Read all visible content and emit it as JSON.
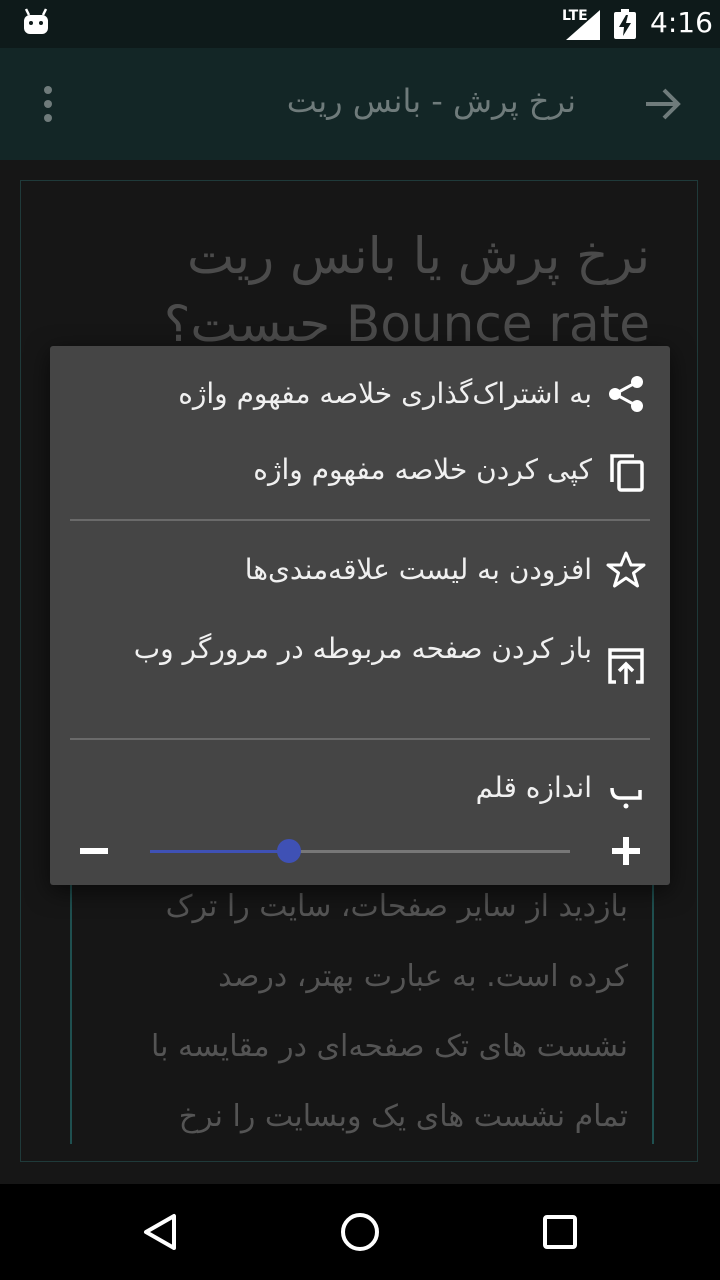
{
  "status_bar": {
    "network": "LTE",
    "time": "4:16",
    "icons": [
      "android-icon",
      "signal-icon",
      "battery-charging-icon"
    ]
  },
  "app_bar": {
    "title": "نرخ پرش - بانس ریت",
    "icons": [
      "more-vert-icon",
      "arrow-forward-icon"
    ]
  },
  "article": {
    "heading": "نرخ پرش یا بانس ریت\nBounce rate چیست؟",
    "paragraph": "بازدید از سایر صفحات، سایت را ترک\nکرده است. به عبارت بهتر، درصد\nنشست های تک صفحه‌ای در مقایسه با\nتمام نشست های یک وبسایت را نرخ"
  },
  "popup_menu": {
    "items": [
      {
        "label": "به اشتراک‌گذاری خلاصه مفهوم واژه",
        "icon": "share-icon"
      },
      {
        "label": "کپی کردن خلاصه مفهوم واژه",
        "icon": "copy-icon"
      },
      {
        "label": "افزودن به لیست علاقه‌مندی‌ها",
        "icon": "star-outline-icon"
      },
      {
        "label": "باز کردن صفحه مربوطه در مرورگر وب",
        "icon": "open-in-browser-icon"
      },
      {
        "label": "اندازه قلم",
        "icon": "font-size-icon"
      }
    ],
    "font_size_slider": {
      "value_fraction": 0.33
    }
  },
  "nav_bar": {
    "icons": [
      "back-triangle-icon",
      "home-circle-icon",
      "recents-square-icon"
    ]
  },
  "colors": {
    "status_bar_bg": "#0e1a1a",
    "app_bar_bg": "#132626",
    "popup_bg": "#454545",
    "accent": "#3f51b5"
  }
}
